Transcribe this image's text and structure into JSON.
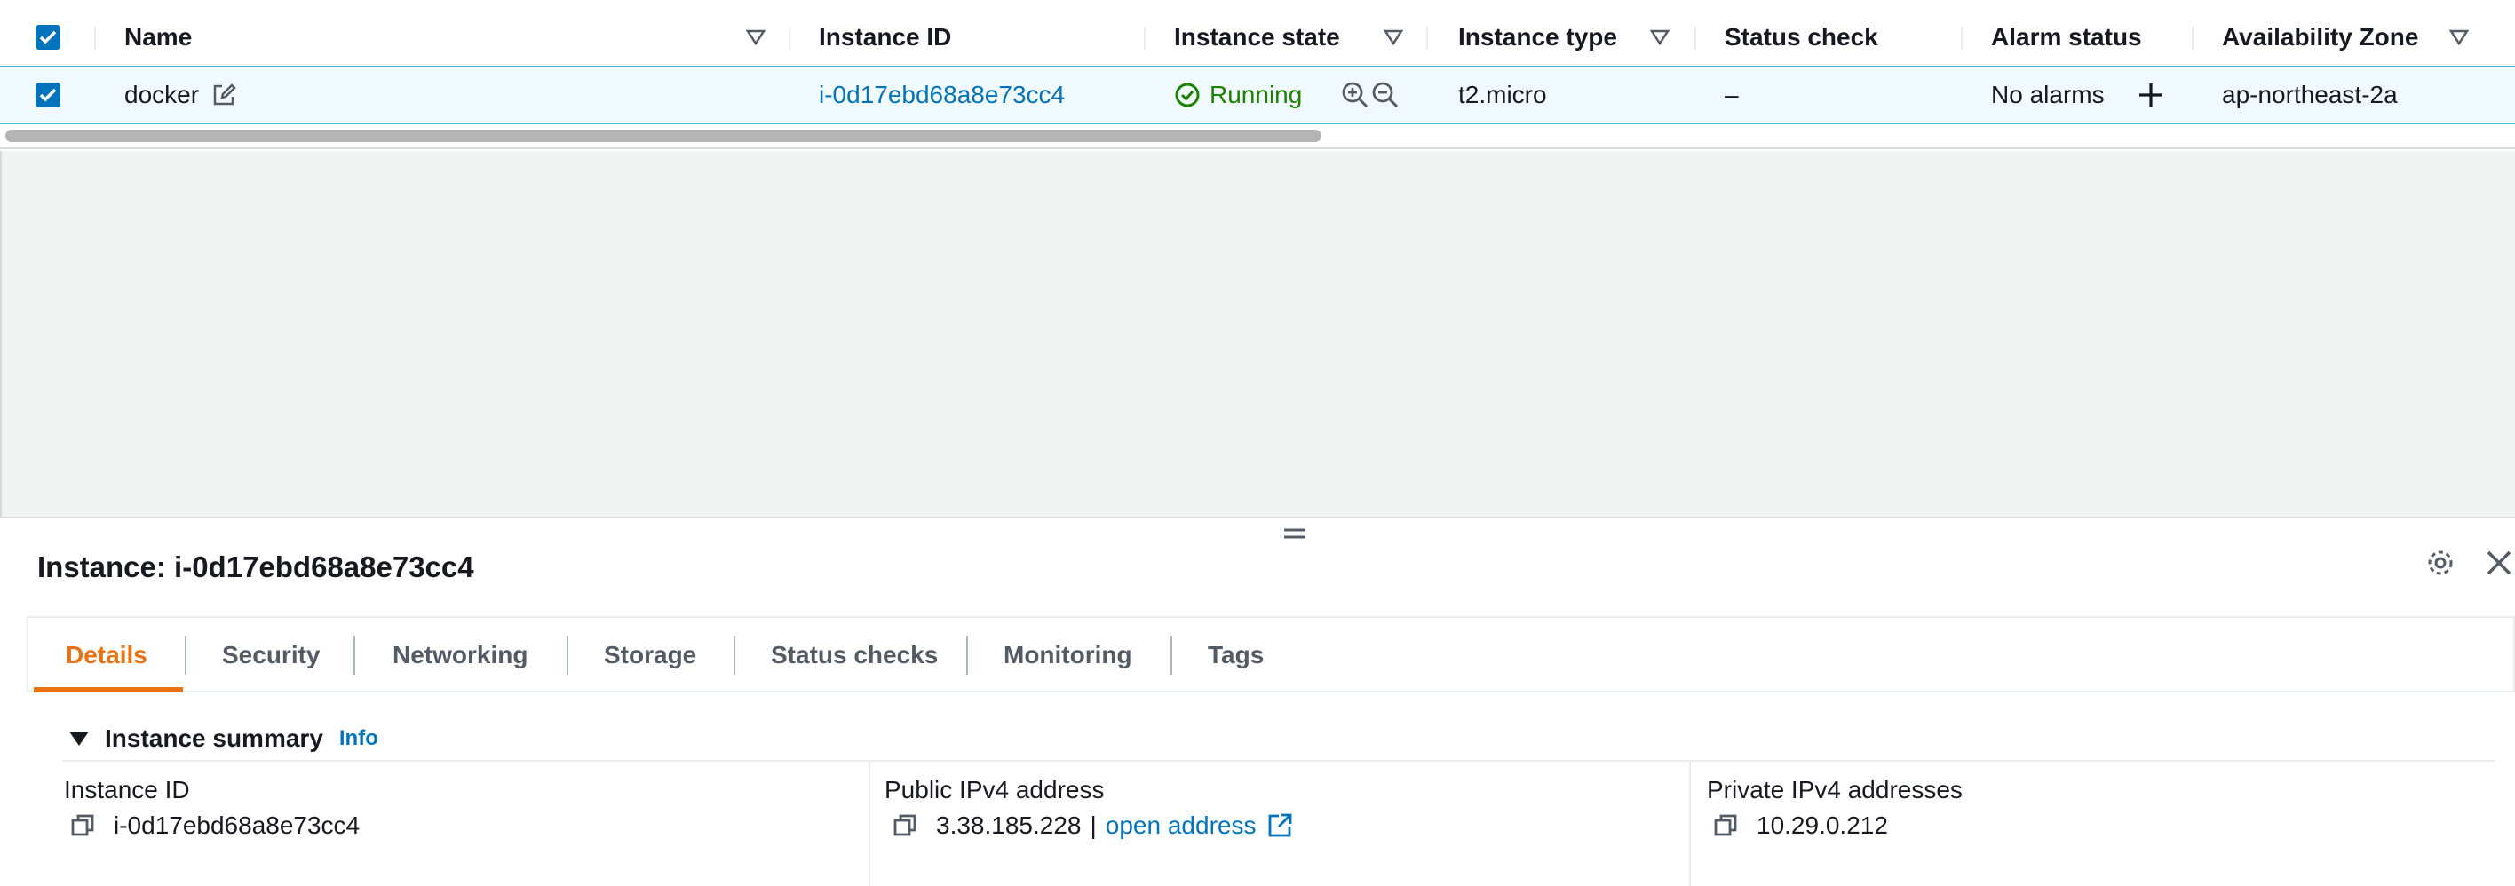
{
  "table": {
    "headers": {
      "name": "Name",
      "instance_id": "Instance ID",
      "instance_state": "Instance state",
      "instance_type": "Instance type",
      "status_check": "Status check",
      "alarm_status": "Alarm status",
      "availability_zone": "Availability Zone"
    },
    "row": {
      "name": "docker",
      "instance_id": "i-0d17ebd68a8e73cc4",
      "instance_state": "Running",
      "instance_type": "t2.micro",
      "status_check": "–",
      "alarm_status": "No alarms",
      "availability_zone": "ap-northeast-2a"
    }
  },
  "panel": {
    "title": "Instance: i-0d17ebd68a8e73cc4",
    "tabs": [
      {
        "label": "Details"
      },
      {
        "label": "Security"
      },
      {
        "label": "Networking"
      },
      {
        "label": "Storage"
      },
      {
        "label": "Status checks"
      },
      {
        "label": "Monitoring"
      },
      {
        "label": "Tags"
      }
    ],
    "active_tab": "Details",
    "section_title": "Instance summary",
    "info_label": "Info",
    "attributes": {
      "instance_id_label": "Instance ID",
      "instance_id_value": "i-0d17ebd68a8e73cc4",
      "public_ipv4_label": "Public IPv4 address",
      "public_ipv4_value": "3.38.185.228",
      "public_ipv4_separator": "|",
      "open_address_label": "open address",
      "private_ipv4_label": "Private IPv4 addresses",
      "private_ipv4_value": "10.29.0.212"
    }
  },
  "colors": {
    "link": "#0073bb",
    "running": "#1d8102",
    "active_tab": "#ec7211",
    "selected_row_bg": "#f1faff",
    "selected_row_border": "#44b9d6"
  },
  "icons": [
    "checkbox-checked-icon",
    "filter-icon",
    "edit-icon",
    "check-circle-icon",
    "zoom-in-icon",
    "zoom-out-icon",
    "plus-icon",
    "drag-handle-icon",
    "gear-icon",
    "close-icon",
    "caret-down-icon",
    "copy-icon",
    "external-link-icon"
  ]
}
